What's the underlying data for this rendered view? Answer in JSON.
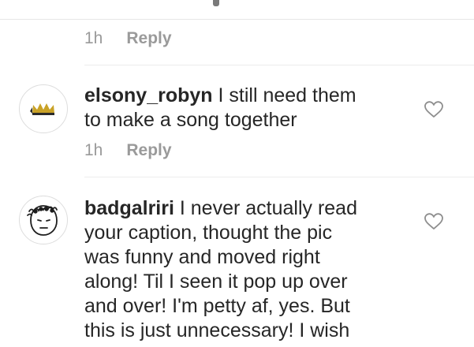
{
  "comments": [
    {
      "time": "1h",
      "reply_label": "Reply"
    },
    {
      "username": "elsony_robyn",
      "text": " I still need them\nto make a song together",
      "time": "1h",
      "reply_label": "Reply",
      "avatar_icon": "crown-icon",
      "like_icon": "heart-outline-icon"
    },
    {
      "username": "badgalriri",
      "text": " I never actually read\nyour caption, thought the pic\nwas funny and moved right\nalong! Til I seen it pop up over\nand over! I'm petty af, yes. But\nthis is just unnecessary! I wish",
      "avatar_icon": "doodle-face-icon",
      "like_icon": "heart-outline-icon"
    }
  ],
  "colors": {
    "text": "#262626",
    "meta": "#9a9a9a",
    "divider": "#ececec",
    "crown": "#c9a227"
  }
}
